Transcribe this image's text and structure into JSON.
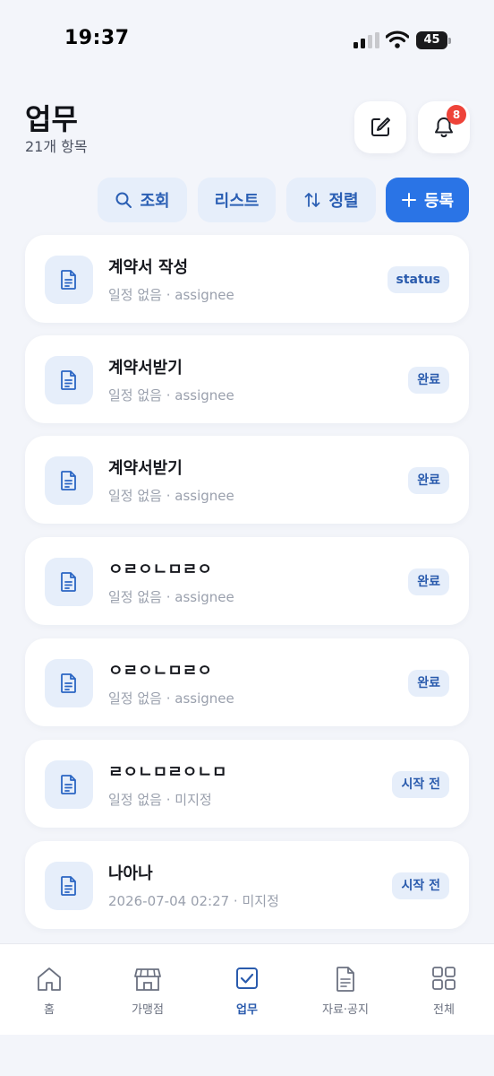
{
  "status_bar": {
    "time": "19:37",
    "battery": "45"
  },
  "header": {
    "title": "업무",
    "count": "21개 항목",
    "notification_count": "8"
  },
  "toolbar": {
    "search_label": "조회",
    "list_label": "리스트",
    "sort_label": "정렬",
    "register_label": "등록"
  },
  "tasks": [
    {
      "title": "계약서 작성",
      "subtitle": "일정 없음 · assignee",
      "status": "status"
    },
    {
      "title": "계약서받기",
      "subtitle": "일정 없음 · assignee",
      "status": "완료"
    },
    {
      "title": "계약서받기",
      "subtitle": "일정 없음 · assignee",
      "status": "완료"
    },
    {
      "title": "ㅇㄹㅇㄴㅁㄹㅇ",
      "subtitle": "일정 없음 · assignee",
      "status": "완료"
    },
    {
      "title": "ㅇㄹㅇㄴㅁㄹㅇ",
      "subtitle": "일정 없음 · assignee",
      "status": "완료"
    },
    {
      "title": "ㄹㅇㄴㅁㄹㅇㄴㅁ",
      "subtitle": "일정 없음 · 미지정",
      "status": "시작 전"
    },
    {
      "title": "나아나",
      "subtitle": "2026-07-04 02:27 · 미지정",
      "status": "시작 전"
    }
  ],
  "bottom_nav": [
    {
      "label": "홈",
      "icon": "home-icon"
    },
    {
      "label": "가맹점",
      "icon": "store-icon"
    },
    {
      "label": "업무",
      "icon": "checkbox-icon",
      "active": true
    },
    {
      "label": "자료·공지",
      "icon": "document-icon"
    },
    {
      "label": "전체",
      "icon": "grid-icon"
    }
  ],
  "colors": {
    "accent": "#2a74e6",
    "accent_text": "#2a5bad",
    "chip_bg": "#e6eefa",
    "badge": "#ee4339",
    "background": "#f3f5fa"
  }
}
